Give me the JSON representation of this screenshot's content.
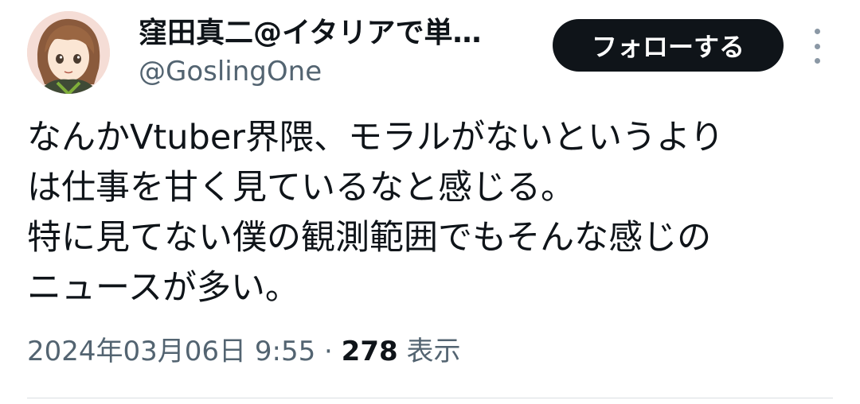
{
  "author": {
    "display_name": "窪田真二@イタリアで単…",
    "handle": "@GoslingOne",
    "avatar_icon": "anime-avatar"
  },
  "actions": {
    "follow_label": "フォローする",
    "more_icon": "vertical-ellipsis-icon"
  },
  "tweet": {
    "text": "なんかVtuber界隈、モラルがないというより\nは仕事を甘く見ているなと感じる。\n特に見てない僕の観測範囲でもそんな感じの\nニュースが多い。",
    "timestamp": "2024年03月06日 9:55",
    "separator": "·",
    "views_count": "278",
    "views_label": "表示"
  },
  "colors": {
    "text_primary": "#0f1419",
    "text_secondary": "#536471",
    "follow_button_bg": "#0f1419",
    "follow_button_text": "#ffffff"
  }
}
